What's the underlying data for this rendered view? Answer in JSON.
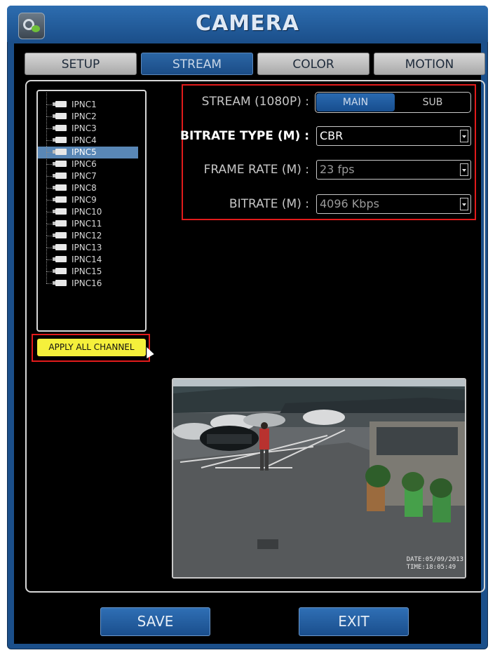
{
  "window": {
    "title": "CAMERA",
    "app_icon": "camera-settings-icon"
  },
  "tabs": [
    {
      "label": "SETUP",
      "active": false
    },
    {
      "label": "STREAM",
      "active": true
    },
    {
      "label": "COLOR",
      "active": false
    },
    {
      "label": "MOTION",
      "active": false
    }
  ],
  "channels": {
    "items": [
      "IPNC1",
      "IPNC2",
      "IPNC3",
      "IPNC4",
      "IPNC5",
      "IPNC6",
      "IPNC7",
      "IPNC8",
      "IPNC9",
      "IPNC10",
      "IPNC11",
      "IPNC12",
      "IPNC13",
      "IPNC14",
      "IPNC15",
      "IPNC16"
    ],
    "selected": "IPNC5",
    "apply_all_label": "APPLY ALL CHANNEL"
  },
  "form": {
    "stream": {
      "label": "STREAM (1080P) :",
      "options": [
        "MAIN",
        "SUB"
      ],
      "selected": "MAIN"
    },
    "bitrate_type": {
      "label": "BITRATE TYPE (M) :",
      "value": "CBR"
    },
    "frame_rate": {
      "label": "FRAME RATE (M) :",
      "value": "23 fps"
    },
    "bitrate": {
      "label": "BITRATE (M) :",
      "value": "4096 Kbps"
    }
  },
  "preview": {
    "date_line": "DATE:05/09/2013",
    "time_line": "TIME:18:05:49"
  },
  "footer": {
    "save_label": "SAVE",
    "exit_label": "EXIT"
  },
  "colors": {
    "frame": "#1b4f8a",
    "tab_active": "#1b4c86",
    "apply_button": "#f5f03b",
    "highlight": "#e21b1b"
  }
}
